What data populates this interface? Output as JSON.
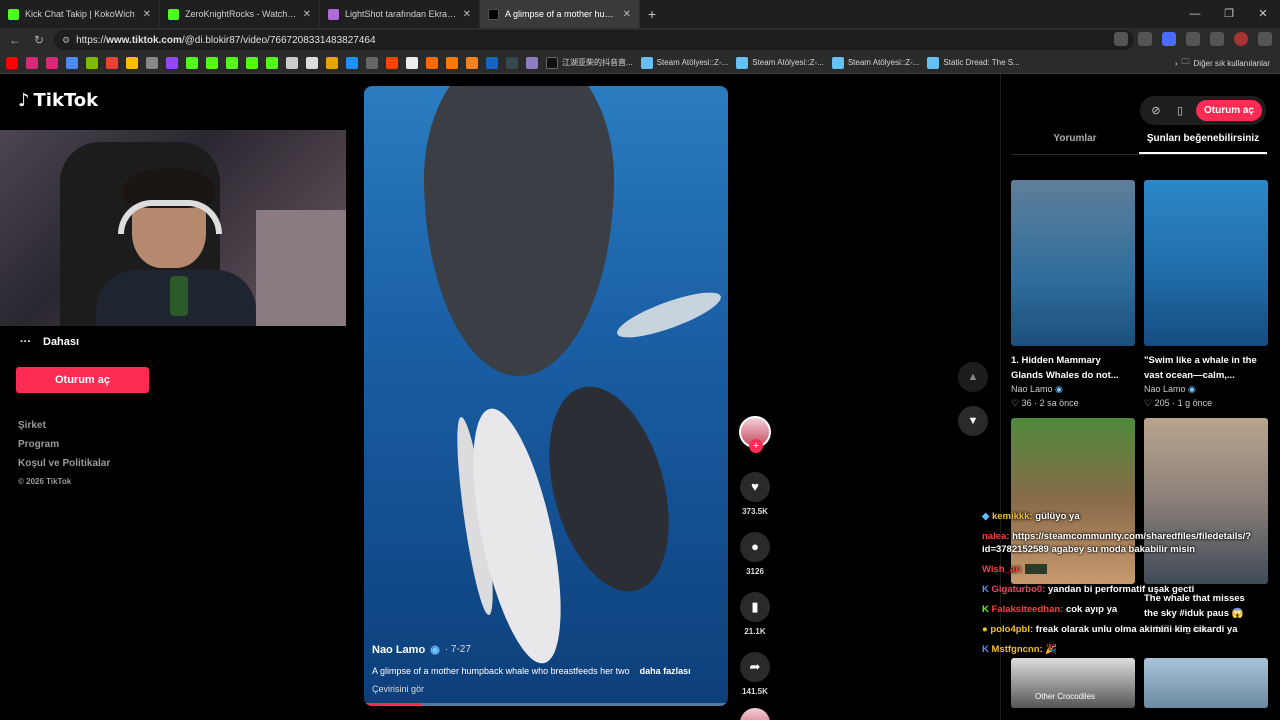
{
  "browser": {
    "tabs": [
      {
        "title": "Kick Chat Takip | KokoWich",
        "color": "#53fc18",
        "active": false
      },
      {
        "title": "ZeroKnightRocks - Watch clips on",
        "color": "#53fc18",
        "active": false
      },
      {
        "title": "LightShot tarafından Ekran Görünt",
        "color": "#b06ad9",
        "active": false
      },
      {
        "title": "A glimpse of a mother humpback",
        "color": "#000000",
        "active": true
      }
    ],
    "url_prefix": "https://",
    "url_domain": "www.tiktok.com",
    "url_path": "/@di.blokir87/video/7667208331483827464",
    "bookmarks": [
      {
        "label": "江湖亚柴的抖音直...",
        "color": "#ffffff"
      },
      {
        "label": "Steam Atölyesi::Z-...",
        "color": "#66c0f4"
      },
      {
        "label": "Steam Atölyesi::Z-...",
        "color": "#66c0f4"
      },
      {
        "label": "Steam Atölyesi::Z-...",
        "color": "#66c0f4"
      },
      {
        "label": "Static Dread: The S...",
        "color": "#66c0f4"
      }
    ],
    "bookmark_other": "Diğer sık kullanılanlar"
  },
  "tiktok": {
    "logo": "TikTok",
    "more_label": "Dahası",
    "login_label": "Oturum aç",
    "footer": [
      "Şirket",
      "Program",
      "Koşul ve Politikalar"
    ],
    "copyright": "© 2026 TikTok",
    "video": {
      "author": "Nao Lamo",
      "date": "· 7-27",
      "description": "A glimpse of a mother humpback whale who breastfeeds her two",
      "more": "daha fazlası",
      "translate": "Çevirisini gör",
      "progress": 0.16
    },
    "actions": {
      "likes": "373.5K",
      "comments": "3126",
      "saves": "21.1K",
      "shares": "141.5K"
    },
    "right_panel": {
      "login_label": "Oturum aç",
      "tab_comments": "Yorumlar",
      "tab_suggested": "Şunları beğenebilirsiniz",
      "cards": [
        {
          "title": "1. Hidden Mammary Glands Whales do not...",
          "author": "Nao Lamo",
          "likes": "36",
          "time": "2 sa önce"
        },
        {
          "title": "\"Swim like a whale in the vast ocean—calm,...",
          "author": "Nao Lamo",
          "likes": "205",
          "time": "1 g önce"
        },
        {
          "title": "",
          "author": "",
          "likes": "",
          "time": ""
        },
        {
          "title": "The whale that misses the sky #iduk paus 😱",
          "author": "",
          "likes": "167",
          "time": "5 g önce"
        }
      ],
      "bottom_thumb_label": "Other Crocodiles"
    }
  },
  "chat": [
    {
      "user": "kemikkk:",
      "msg": "gülüyo ya",
      "style": "y"
    },
    {
      "user": "nalea:",
      "msg": "https://steamcommunity.com/sharedfiles/filedetails/?id=3782152589 agabey su moda bakabilir misin",
      "style": ""
    },
    {
      "user": "Wish_ar:",
      "msg": "",
      "style": ""
    },
    {
      "user": "Gigaturbo0:",
      "msg": "yandan bi performatif uşak gecti",
      "style": "p"
    },
    {
      "user": "Falaksiteedhan:",
      "msg": "cok ayıp ya",
      "style": ""
    },
    {
      "user": "polo4pbl:",
      "msg": "freak olarak unlu olma akimini kim cikardi ya",
      "style": "y"
    },
    {
      "user": "Mstfgncnn:",
      "msg": "🎉",
      "style": "y"
    }
  ]
}
